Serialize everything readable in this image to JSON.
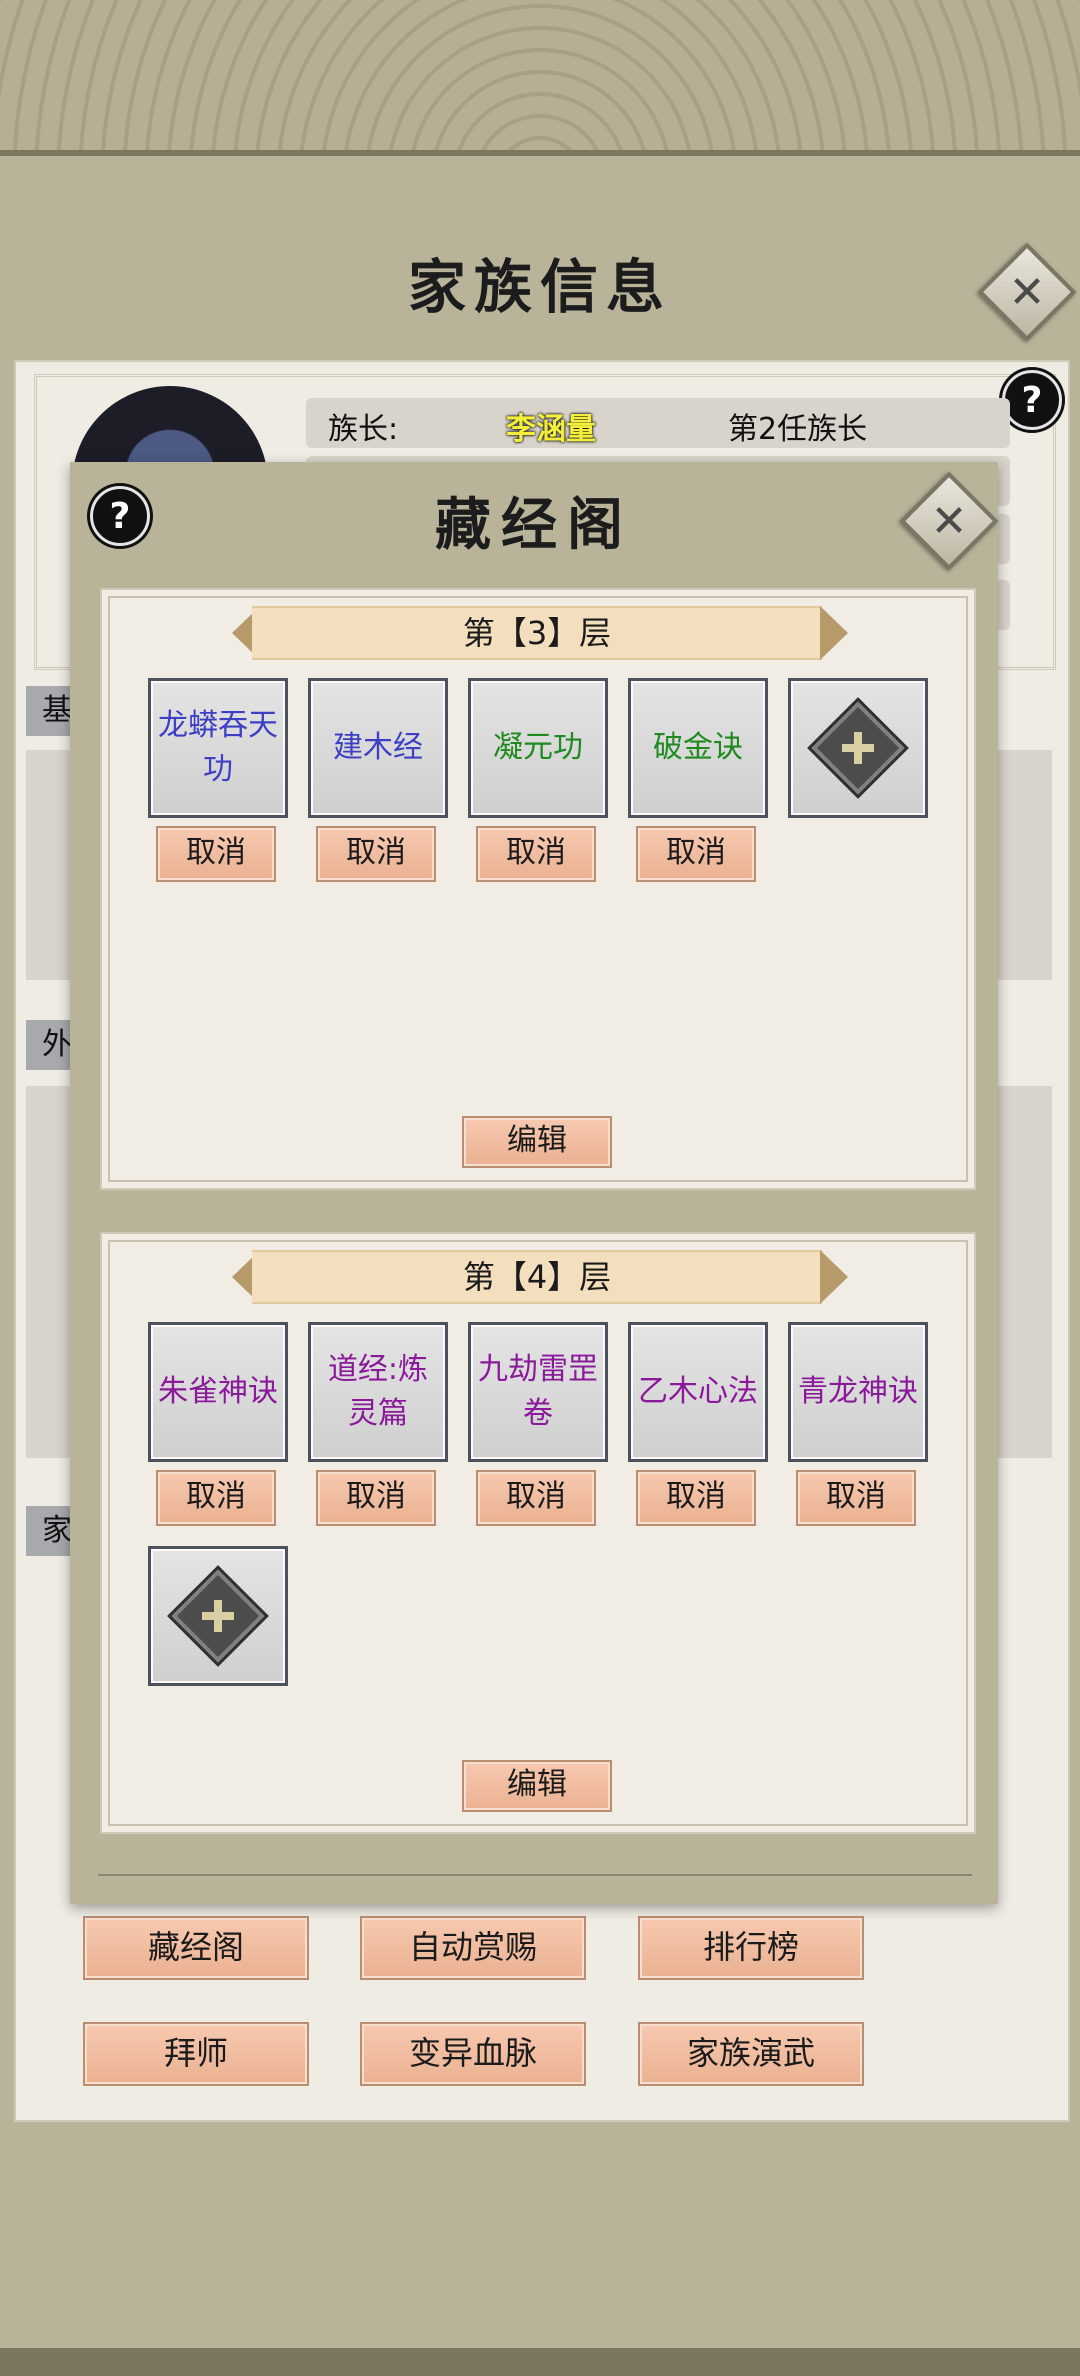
{
  "header": {
    "title": "家族信息",
    "close_icon": "close-icon",
    "help_label": "?"
  },
  "base": {
    "leader_key": "族长:",
    "leader_name": "李涵量",
    "leader_rank": "第2任族长",
    "left_tabs": [
      "基",
      "外",
      "家"
    ]
  },
  "bottom_buttons": [
    {
      "label": "藏经阁"
    },
    {
      "label": "自动赏赐"
    },
    {
      "label": "排行榜"
    },
    {
      "label": "拜师"
    },
    {
      "label": "变异血脉"
    },
    {
      "label": "家族演武"
    }
  ],
  "library": {
    "title": "藏经阁",
    "help_label": "?",
    "colors": {
      "blue": "#3d3fc4",
      "green": "#1f8a1f",
      "purple": "#8a1a9a"
    },
    "floors": [
      {
        "label": "第【3】层",
        "slots": [
          {
            "name": "龙蟒吞天功",
            "color": "blue"
          },
          {
            "name": "建木经",
            "color": "blue"
          },
          {
            "name": "凝元功",
            "color": "green"
          },
          {
            "name": "破金诀",
            "color": "green"
          }
        ],
        "cancel_label": "取消",
        "edit_label": "编辑"
      },
      {
        "label": "第【4】层",
        "slots": [
          {
            "name": "朱雀神诀",
            "color": "purple"
          },
          {
            "name": "道经:炼灵篇",
            "color": "purple"
          },
          {
            "name": "九劫雷罡卷",
            "color": "purple"
          },
          {
            "name": "乙木心法",
            "color": "purple"
          },
          {
            "name": "青龙神诀",
            "color": "purple"
          }
        ],
        "cancel_label": "取消",
        "edit_label": "编辑"
      }
    ]
  }
}
